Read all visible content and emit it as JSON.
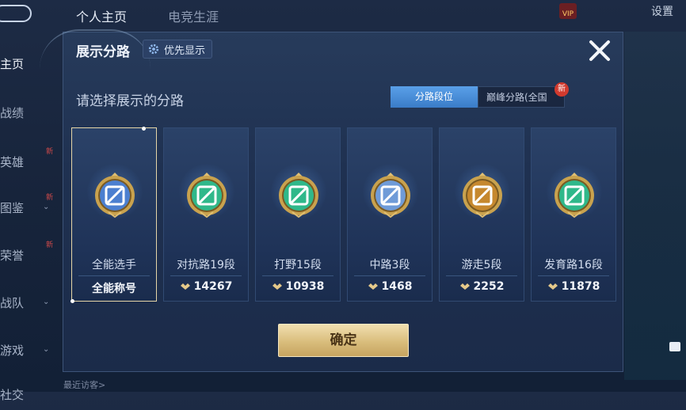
{
  "background": {
    "nav_tabs": [
      "个人主页",
      "电竞生涯"
    ],
    "settings_label": "设置",
    "vip_label": "VIP",
    "sidebar_items": [
      {
        "label": "主页",
        "active": true,
        "new": false
      },
      {
        "label": "战绩",
        "active": false,
        "new": false
      },
      {
        "label": "英雄",
        "active": false,
        "new": true
      },
      {
        "label": "图鉴",
        "active": false,
        "new": true
      },
      {
        "label": "荣誉",
        "active": false,
        "new": true
      },
      {
        "label": "战队",
        "active": false,
        "new": false
      },
      {
        "label": "游戏",
        "active": false,
        "new": false
      },
      {
        "label": "社交",
        "active": false,
        "new": false
      }
    ],
    "new_badge": "新",
    "recent_visitors": "最近访客>"
  },
  "modal": {
    "title": "展示分路",
    "priority_button": "优先显示",
    "subtitle": "请选择展示的分路",
    "tabs": [
      {
        "label": "分路段位",
        "active": true
      },
      {
        "label": "巅峰分路(全国",
        "active": false,
        "badge": "新"
      }
    ],
    "cards": [
      {
        "name": "全能选手",
        "value": "全能称号",
        "selected": true,
        "icon": "all-rounder-emblem-icon",
        "color": "#4b7fd0"
      },
      {
        "name": "对抗路19段",
        "value": "14267",
        "selected": false,
        "icon": "clash-lane-emblem-icon",
        "color": "#2fb88a"
      },
      {
        "name": "打野15段",
        "value": "10938",
        "selected": false,
        "icon": "jungle-emblem-icon",
        "color": "#2fb88a"
      },
      {
        "name": "中路3段",
        "value": "1468",
        "selected": false,
        "icon": "mid-lane-emblem-icon",
        "color": "#6f9bd8"
      },
      {
        "name": "游走5段",
        "value": "2252",
        "selected": false,
        "icon": "roam-emblem-icon",
        "color": "#c6882e"
      },
      {
        "name": "发育路16段",
        "value": "11878",
        "selected": false,
        "icon": "farm-lane-emblem-icon",
        "color": "#2fb88a"
      }
    ],
    "confirm_label": "确定"
  }
}
